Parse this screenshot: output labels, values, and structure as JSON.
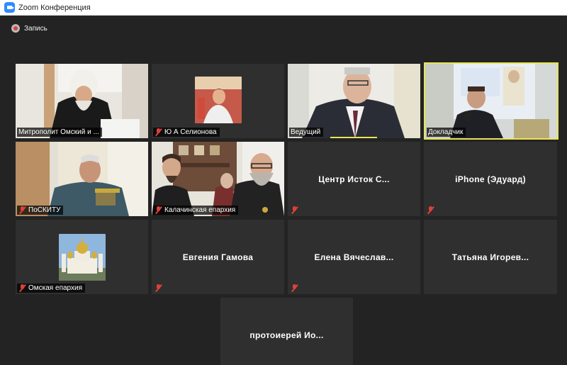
{
  "window": {
    "title": "Zoom Конференция"
  },
  "recording": {
    "label": "Запись"
  },
  "tiles": [
    {
      "name": "Митрополит Омский и ..."
    },
    {
      "name": "Ю А Селионова"
    },
    {
      "name": "Ведущий"
    },
    {
      "name": "Докладчик"
    },
    {
      "name": "ПоСКИТУ"
    },
    {
      "name": "Калачинская епархия"
    },
    {
      "name": "Центр Исток С..."
    },
    {
      "name": "iPhone (Эдуард)"
    },
    {
      "name": "Омская епархия"
    },
    {
      "name": "Евгения Гамова"
    },
    {
      "name": "Елена Вячеслав..."
    },
    {
      "name": "Татьяна Игорев..."
    },
    {
      "name": "протоиерей Ио..."
    }
  ],
  "colors": {
    "active_speaker_border": "#e6e45a",
    "mute_icon": "#e0403a",
    "background": "#232323"
  }
}
